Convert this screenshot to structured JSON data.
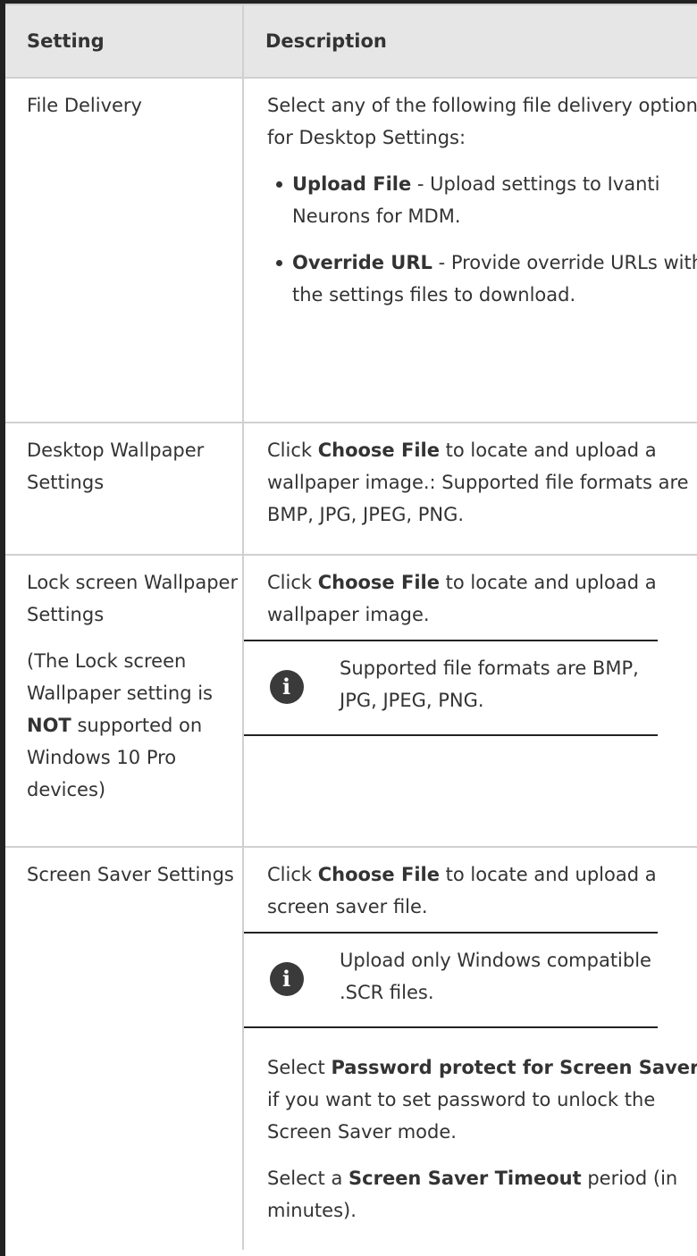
{
  "table": {
    "headers": [
      "Setting",
      "Description"
    ],
    "rows": {
      "file_delivery": {
        "setting": "File Delivery",
        "intro": "Select any of the following file delivery options for Desktop Settings:",
        "items": [
          {
            "bold": "Upload File",
            "text": " - Upload settings to Ivanti Neurons for MDM."
          },
          {
            "bold": "Override URL",
            "text": " - Provide override URLs with the settings files to download."
          }
        ]
      },
      "desktop_wallpaper": {
        "setting": "Desktop Wallpaper Settings",
        "pre": "Click ",
        "bold": "Choose File",
        "post": " to locate and upload a wallpaper image.: Supported file formats are BMP, JPG, JPEG, PNG."
      },
      "lock_screen": {
        "setting": "Lock screen Wallpaper Settings",
        "note_pre": "(The Lock screen Wallpaper setting is ",
        "note_bold": "NOT",
        "note_post": " supported on Windows 10 Pro devices)",
        "pre": "Click ",
        "bold": "Choose File",
        "post": " to locate and upload a wallpaper image.",
        "info": "Supported file formats are BMP, JPG, JPEG, PNG.",
        "icon": "info-icon"
      },
      "screen_saver": {
        "setting": "Screen Saver Settings",
        "pre": "Click ",
        "bold": "Choose File",
        "post": " to locate and upload a screen saver file.",
        "info": "Upload only Windows compatible .SCR files.",
        "icon": "info-icon",
        "pw_pre": "Select ",
        "pw_bold": "Password protect for Screen Saver",
        "pw_post": " if you want to set password to unlock the Screen Saver mode.",
        "to_pre": "Select a ",
        "to_bold": "Screen Saver Timeout",
        "to_post": " period (in minutes)."
      }
    }
  }
}
